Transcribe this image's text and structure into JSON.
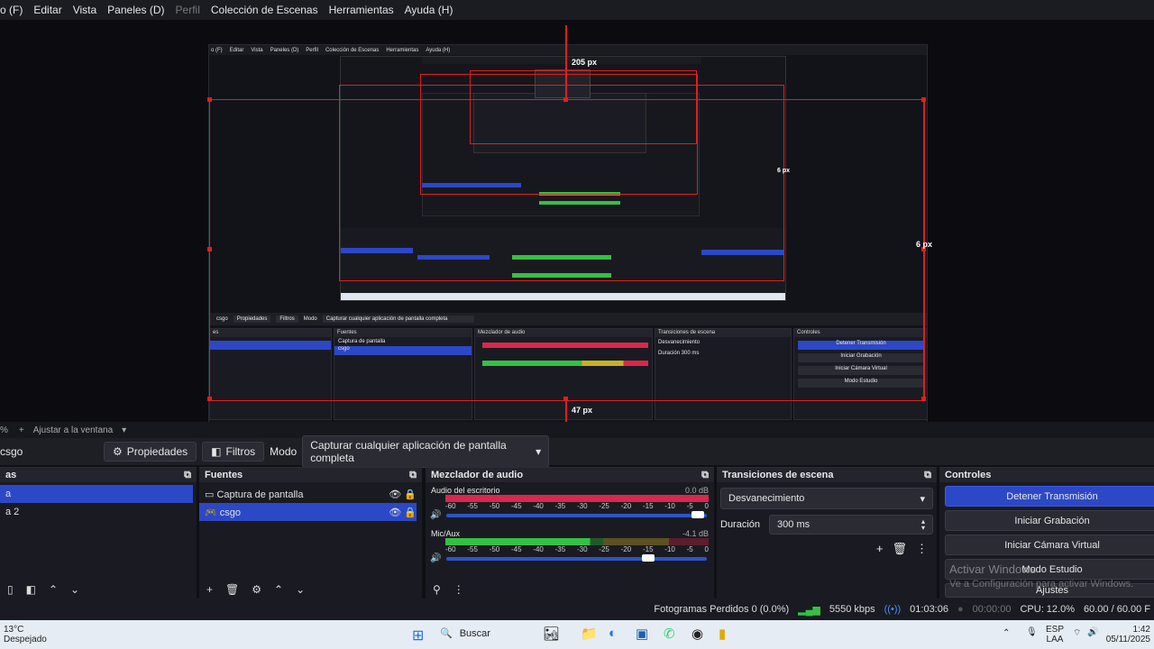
{
  "menu": {
    "items": [
      "o (F)",
      "Editar",
      "Vista",
      "Paneles (D)",
      "Perfil",
      "Colección de Escenas",
      "Herramientas",
      "Ayuda (H)"
    ],
    "disabled_index": 4
  },
  "preview": {
    "label_205": "205 px",
    "label_6a": "6 px",
    "label_6b": "6 px",
    "label_47": "47 px"
  },
  "scroll": {
    "zoom_suffix": "%",
    "fit_label": "Ajustar a la ventana"
  },
  "toolbar": {
    "source_name": "csgo",
    "properties_label": "Propiedades",
    "filters_label": "Filtros",
    "mode_label": "Modo",
    "mode_value": "Capturar cualquier aplicación de pantalla completa"
  },
  "scenes": {
    "title": "as",
    "items": [
      "a",
      "a 2"
    ],
    "selected_index": 0
  },
  "sources": {
    "title": "Fuentes",
    "items": [
      "Captura de pantalla",
      "csgo"
    ],
    "selected_index": 1
  },
  "mixer": {
    "title": "Mezclador de audio",
    "channels": [
      {
        "name": "Audio del escritorio",
        "db": "0.0 dB",
        "level": 1.0,
        "volume": 0.99
      },
      {
        "name": "Mic/Aux",
        "db": "-4.1 dB",
        "level": 0.55,
        "volume": 0.8
      }
    ],
    "ticks": [
      "-60",
      "-55",
      "-50",
      "-45",
      "-40",
      "-35",
      "-30",
      "-25",
      "-20",
      "-15",
      "-10",
      "-5",
      "0"
    ]
  },
  "transitions": {
    "title": "Transiciones de escena",
    "transition": "Desvanecimiento",
    "duration_label": "Duración",
    "duration_value": "300 ms"
  },
  "controls": {
    "title": "Controles",
    "buttons": [
      "Detener Transmisión",
      "Iniciar Grabación",
      "Iniciar Cámara Virtual",
      "Modo Estudio",
      "Ajustes"
    ],
    "watermark_title": "Activar Windows",
    "watermark_sub": "Ve a Configuración para activar Windows."
  },
  "status": {
    "dropped": "Fotogramas Perdidos 0 (0.0%)",
    "bitrate": "5550 kbps",
    "live_time": "01:03:06",
    "rec_time": "00:00:00",
    "cpu": "CPU: 12.0%",
    "fps": "60.00 / 60.00 F"
  },
  "taskbar": {
    "weather_temp": "13°C",
    "weather_desc": "Despejado",
    "search_placeholder": "Buscar",
    "lang_top": "ESP",
    "lang_bottom": "LAA",
    "time": "1:42",
    "date": "05/11/2025"
  },
  "colors": {
    "accent": "#2c48c6",
    "meter_red": "#d8284d",
    "meter_green": "#35c045",
    "meter_yellow": "#c8b02a",
    "guide_red": "#e01e1e"
  }
}
